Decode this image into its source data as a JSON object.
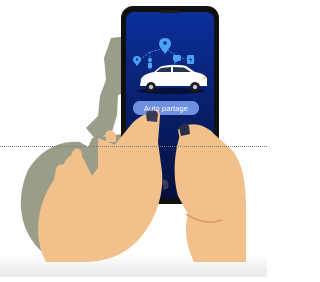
{
  "illustration": {
    "cta_button": {
      "label": "Auto partage"
    },
    "colors": {
      "phone_body": "#101010",
      "screen_top": "#0b2f9c",
      "screen_bottom": "#06103d",
      "button_fill": "#6f8fe0",
      "hand_skin": "#f2c08a",
      "hand_shadow": "#9c9d88",
      "pin_blue": "#4ba3f5"
    },
    "icons": [
      "location-pin-icon",
      "person-icon",
      "ev-charging-icon",
      "chat-icon",
      "car-icon"
    ]
  }
}
